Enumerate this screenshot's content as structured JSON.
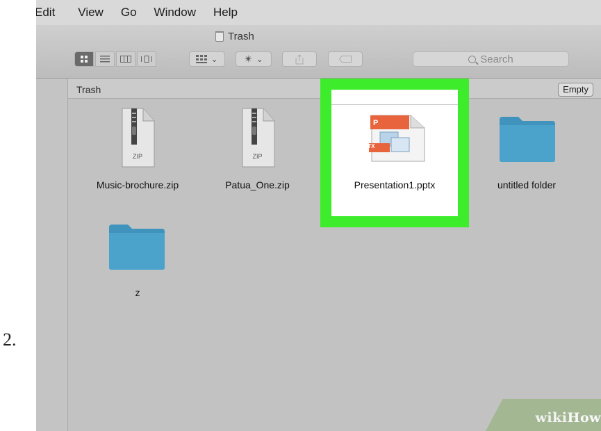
{
  "step_number": "2.",
  "menubar": {
    "items": [
      "Edit",
      "View",
      "Go",
      "Window",
      "Help"
    ]
  },
  "window": {
    "title": "Trash"
  },
  "search": {
    "placeholder": "Search"
  },
  "pathbar": {
    "label": "Trash",
    "empty_button": "Empty"
  },
  "files": [
    {
      "name": "Music-brochure.zip",
      "type": "zip",
      "icon": "zip-file-icon",
      "badge": "ZIP"
    },
    {
      "name": "Patua_One.zip",
      "type": "zip",
      "icon": "zip-file-icon",
      "badge": "ZIP"
    },
    {
      "name": "Presentation1.pptx",
      "type": "pptx",
      "icon": "pptx-file-icon",
      "badge": "PPTX",
      "highlighted": true
    },
    {
      "name": "untitled folder",
      "type": "folder",
      "icon": "folder-icon"
    },
    {
      "name": "z",
      "type": "folder",
      "icon": "folder-icon"
    }
  ],
  "watermark": {
    "part1": "wiki",
    "part2": "How"
  },
  "colors": {
    "highlight": "#3ded2b",
    "folder": "#4ba3cc",
    "pptx_orange": "#e8643c"
  }
}
